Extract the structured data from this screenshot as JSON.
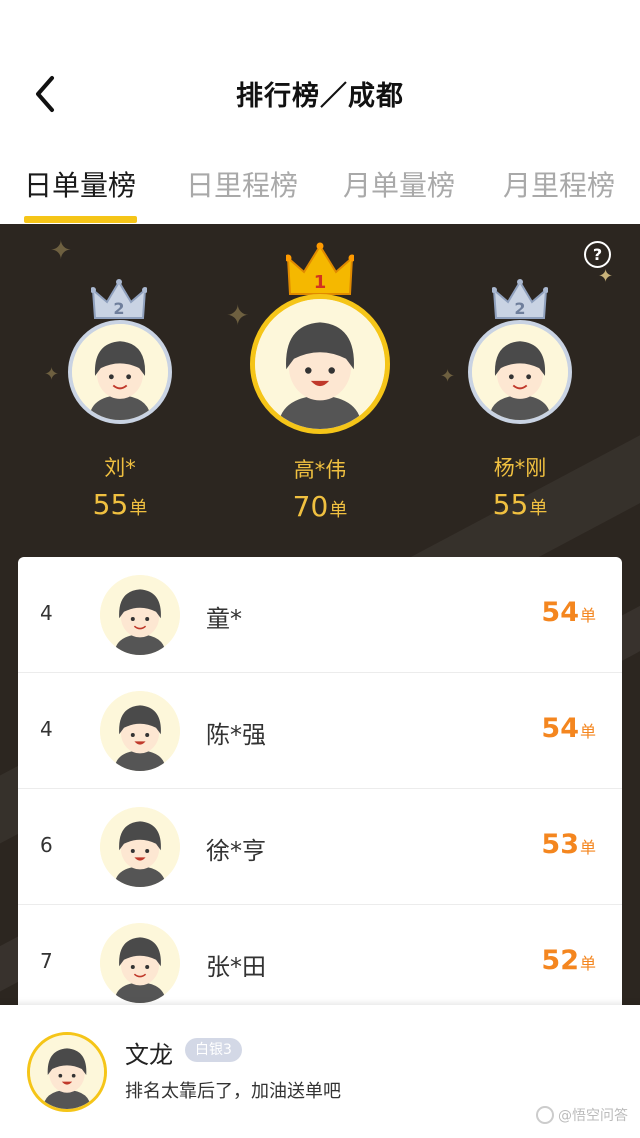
{
  "header": {
    "title": "排行榜／成都"
  },
  "tabs": [
    {
      "label": "日单量榜",
      "active": true
    },
    {
      "label": "日里程榜",
      "active": false
    },
    {
      "label": "月单量榜",
      "active": false
    },
    {
      "label": "月里程榜",
      "active": false
    }
  ],
  "podium": {
    "help_label": "?",
    "first": {
      "rank_badge": "1",
      "name": "高*伟",
      "count": "70",
      "unit": "单"
    },
    "left": {
      "rank_badge": "2",
      "name": "刘*",
      "count": "55",
      "unit": "单"
    },
    "right": {
      "rank_badge": "2",
      "name": "杨*刚",
      "count": "55",
      "unit": "单"
    }
  },
  "list": [
    {
      "rank": "4",
      "name": "童*",
      "count": "54",
      "unit": "单"
    },
    {
      "rank": "4",
      "name": "陈*强",
      "count": "54",
      "unit": "单"
    },
    {
      "rank": "6",
      "name": "徐*亨",
      "count": "53",
      "unit": "单"
    },
    {
      "rank": "7",
      "name": "张*田",
      "count": "52",
      "unit": "单"
    }
  ],
  "self": {
    "name": "文龙",
    "badge": "白银3",
    "message": "排名太靠后了，加油送单吧"
  },
  "watermark": "@悟空问答",
  "colors": {
    "accent": "#f5c518",
    "gold_text": "#f0c040",
    "count_orange": "#f4861f",
    "podium_bg": "#2c2620"
  }
}
